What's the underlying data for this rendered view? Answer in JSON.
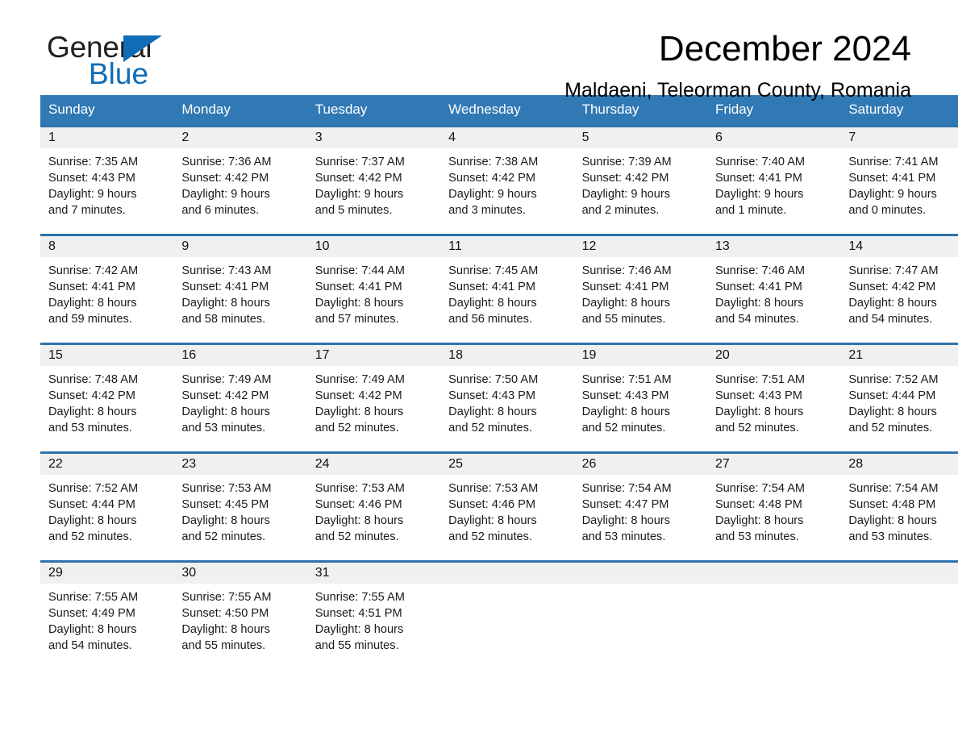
{
  "logo": {
    "word1": "General",
    "word2": "Blue",
    "triangle_color": "#0f6cb6"
  },
  "header": {
    "month_title": "December 2024",
    "location": "Maldaeni, Teleorman County, Romania",
    "accent_color": "#3179b4",
    "row_border_color": "#2e72ad",
    "daynum_band_color": "#f0f0f0"
  },
  "weekday_headers": [
    "Sunday",
    "Monday",
    "Tuesday",
    "Wednesday",
    "Thursday",
    "Friday",
    "Saturday"
  ],
  "weeks": [
    [
      {
        "day": "1",
        "sunrise": "Sunrise: 7:35 AM",
        "sunset": "Sunset: 4:43 PM",
        "daylight1": "Daylight: 9 hours",
        "daylight2": "and 7 minutes."
      },
      {
        "day": "2",
        "sunrise": "Sunrise: 7:36 AM",
        "sunset": "Sunset: 4:42 PM",
        "daylight1": "Daylight: 9 hours",
        "daylight2": "and 6 minutes."
      },
      {
        "day": "3",
        "sunrise": "Sunrise: 7:37 AM",
        "sunset": "Sunset: 4:42 PM",
        "daylight1": "Daylight: 9 hours",
        "daylight2": "and 5 minutes."
      },
      {
        "day": "4",
        "sunrise": "Sunrise: 7:38 AM",
        "sunset": "Sunset: 4:42 PM",
        "daylight1": "Daylight: 9 hours",
        "daylight2": "and 3 minutes."
      },
      {
        "day": "5",
        "sunrise": "Sunrise: 7:39 AM",
        "sunset": "Sunset: 4:42 PM",
        "daylight1": "Daylight: 9 hours",
        "daylight2": "and 2 minutes."
      },
      {
        "day": "6",
        "sunrise": "Sunrise: 7:40 AM",
        "sunset": "Sunset: 4:41 PM",
        "daylight1": "Daylight: 9 hours",
        "daylight2": "and 1 minute."
      },
      {
        "day": "7",
        "sunrise": "Sunrise: 7:41 AM",
        "sunset": "Sunset: 4:41 PM",
        "daylight1": "Daylight: 9 hours",
        "daylight2": "and 0 minutes."
      }
    ],
    [
      {
        "day": "8",
        "sunrise": "Sunrise: 7:42 AM",
        "sunset": "Sunset: 4:41 PM",
        "daylight1": "Daylight: 8 hours",
        "daylight2": "and 59 minutes."
      },
      {
        "day": "9",
        "sunrise": "Sunrise: 7:43 AM",
        "sunset": "Sunset: 4:41 PM",
        "daylight1": "Daylight: 8 hours",
        "daylight2": "and 58 minutes."
      },
      {
        "day": "10",
        "sunrise": "Sunrise: 7:44 AM",
        "sunset": "Sunset: 4:41 PM",
        "daylight1": "Daylight: 8 hours",
        "daylight2": "and 57 minutes."
      },
      {
        "day": "11",
        "sunrise": "Sunrise: 7:45 AM",
        "sunset": "Sunset: 4:41 PM",
        "daylight1": "Daylight: 8 hours",
        "daylight2": "and 56 minutes."
      },
      {
        "day": "12",
        "sunrise": "Sunrise: 7:46 AM",
        "sunset": "Sunset: 4:41 PM",
        "daylight1": "Daylight: 8 hours",
        "daylight2": "and 55 minutes."
      },
      {
        "day": "13",
        "sunrise": "Sunrise: 7:46 AM",
        "sunset": "Sunset: 4:41 PM",
        "daylight1": "Daylight: 8 hours",
        "daylight2": "and 54 minutes."
      },
      {
        "day": "14",
        "sunrise": "Sunrise: 7:47 AM",
        "sunset": "Sunset: 4:42 PM",
        "daylight1": "Daylight: 8 hours",
        "daylight2": "and 54 minutes."
      }
    ],
    [
      {
        "day": "15",
        "sunrise": "Sunrise: 7:48 AM",
        "sunset": "Sunset: 4:42 PM",
        "daylight1": "Daylight: 8 hours",
        "daylight2": "and 53 minutes."
      },
      {
        "day": "16",
        "sunrise": "Sunrise: 7:49 AM",
        "sunset": "Sunset: 4:42 PM",
        "daylight1": "Daylight: 8 hours",
        "daylight2": "and 53 minutes."
      },
      {
        "day": "17",
        "sunrise": "Sunrise: 7:49 AM",
        "sunset": "Sunset: 4:42 PM",
        "daylight1": "Daylight: 8 hours",
        "daylight2": "and 52 minutes."
      },
      {
        "day": "18",
        "sunrise": "Sunrise: 7:50 AM",
        "sunset": "Sunset: 4:43 PM",
        "daylight1": "Daylight: 8 hours",
        "daylight2": "and 52 minutes."
      },
      {
        "day": "19",
        "sunrise": "Sunrise: 7:51 AM",
        "sunset": "Sunset: 4:43 PM",
        "daylight1": "Daylight: 8 hours",
        "daylight2": "and 52 minutes."
      },
      {
        "day": "20",
        "sunrise": "Sunrise: 7:51 AM",
        "sunset": "Sunset: 4:43 PM",
        "daylight1": "Daylight: 8 hours",
        "daylight2": "and 52 minutes."
      },
      {
        "day": "21",
        "sunrise": "Sunrise: 7:52 AM",
        "sunset": "Sunset: 4:44 PM",
        "daylight1": "Daylight: 8 hours",
        "daylight2": "and 52 minutes."
      }
    ],
    [
      {
        "day": "22",
        "sunrise": "Sunrise: 7:52 AM",
        "sunset": "Sunset: 4:44 PM",
        "daylight1": "Daylight: 8 hours",
        "daylight2": "and 52 minutes."
      },
      {
        "day": "23",
        "sunrise": "Sunrise: 7:53 AM",
        "sunset": "Sunset: 4:45 PM",
        "daylight1": "Daylight: 8 hours",
        "daylight2": "and 52 minutes."
      },
      {
        "day": "24",
        "sunrise": "Sunrise: 7:53 AM",
        "sunset": "Sunset: 4:46 PM",
        "daylight1": "Daylight: 8 hours",
        "daylight2": "and 52 minutes."
      },
      {
        "day": "25",
        "sunrise": "Sunrise: 7:53 AM",
        "sunset": "Sunset: 4:46 PM",
        "daylight1": "Daylight: 8 hours",
        "daylight2": "and 52 minutes."
      },
      {
        "day": "26",
        "sunrise": "Sunrise: 7:54 AM",
        "sunset": "Sunset: 4:47 PM",
        "daylight1": "Daylight: 8 hours",
        "daylight2": "and 53 minutes."
      },
      {
        "day": "27",
        "sunrise": "Sunrise: 7:54 AM",
        "sunset": "Sunset: 4:48 PM",
        "daylight1": "Daylight: 8 hours",
        "daylight2": "and 53 minutes."
      },
      {
        "day": "28",
        "sunrise": "Sunrise: 7:54 AM",
        "sunset": "Sunset: 4:48 PM",
        "daylight1": "Daylight: 8 hours",
        "daylight2": "and 53 minutes."
      }
    ],
    [
      {
        "day": "29",
        "sunrise": "Sunrise: 7:55 AM",
        "sunset": "Sunset: 4:49 PM",
        "daylight1": "Daylight: 8 hours",
        "daylight2": "and 54 minutes."
      },
      {
        "day": "30",
        "sunrise": "Sunrise: 7:55 AM",
        "sunset": "Sunset: 4:50 PM",
        "daylight1": "Daylight: 8 hours",
        "daylight2": "and 55 minutes."
      },
      {
        "day": "31",
        "sunrise": "Sunrise: 7:55 AM",
        "sunset": "Sunset: 4:51 PM",
        "daylight1": "Daylight: 8 hours",
        "daylight2": "and 55 minutes."
      },
      {
        "day": "",
        "sunrise": "",
        "sunset": "",
        "daylight1": "",
        "daylight2": ""
      },
      {
        "day": "",
        "sunrise": "",
        "sunset": "",
        "daylight1": "",
        "daylight2": ""
      },
      {
        "day": "",
        "sunrise": "",
        "sunset": "",
        "daylight1": "",
        "daylight2": ""
      },
      {
        "day": "",
        "sunrise": "",
        "sunset": "",
        "daylight1": "",
        "daylight2": ""
      }
    ]
  ]
}
